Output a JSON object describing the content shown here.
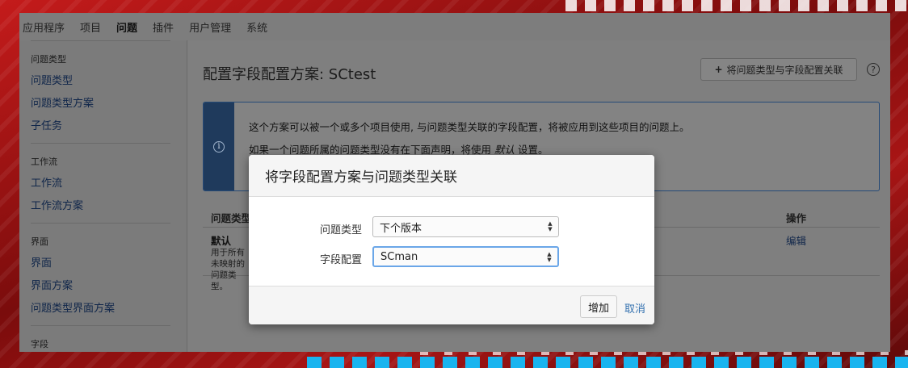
{
  "topnav": {
    "items": [
      "应用程序",
      "项目",
      "问题",
      "插件",
      "用户管理",
      "系统"
    ],
    "active": "问题"
  },
  "sidebar": {
    "sections": [
      {
        "heading": "问题类型",
        "links": [
          "问题类型",
          "问题类型方案",
          "子任务"
        ]
      },
      {
        "heading": "工作流",
        "links": [
          "工作流",
          "工作流方案"
        ]
      },
      {
        "heading": "界面",
        "links": [
          "界面",
          "界面方案",
          "问题类型界面方案"
        ]
      },
      {
        "heading": "字段",
        "links": []
      }
    ]
  },
  "main": {
    "title": "配置字段配置方案: SCtest",
    "associate_button": "将问题类型与字段配置关联",
    "help_icon": "question-circle-icon",
    "info": {
      "line1": "这个方案可以被一个或多个项目使用, 与问题类型关联的字段配置，将被应用到这些项目的问题上。",
      "line2_prefix": "如果一个问题所属的问题类型没有在下面声明，将使用 ",
      "line2_em": "默认",
      "line2_suffix": " 设置。"
    },
    "table": {
      "headers": {
        "issue_type": "问题类型",
        "actions": "操作"
      },
      "rows": [
        {
          "title": "默认",
          "description": "用于所有未映射的问题类型。",
          "action": "编辑"
        }
      ]
    }
  },
  "dialog": {
    "title": "将字段配置方案与问题类型关联",
    "fields": [
      {
        "label": "问题类型",
        "value": "下个版本"
      },
      {
        "label": "字段配置",
        "value": "SCman"
      }
    ],
    "add_button": "增加",
    "cancel_link": "取消"
  },
  "colors": {
    "info_stripe": "#1f3a5c",
    "link": "#3572b0",
    "focus_border": "#6aa6e8"
  }
}
